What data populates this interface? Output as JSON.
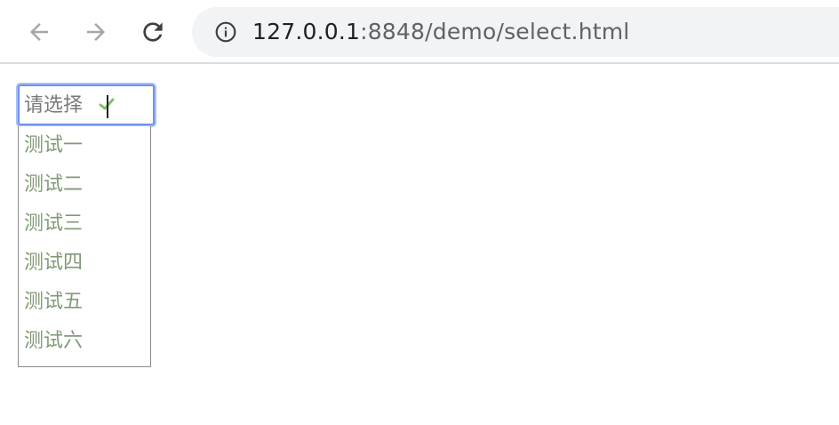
{
  "browser": {
    "url_host": "127.0.0.1",
    "url_path": ":8848/demo/select.html"
  },
  "select": {
    "value": "请选择",
    "options": [
      {
        "label": "测试一"
      },
      {
        "label": "测试二"
      },
      {
        "label": "测试三"
      },
      {
        "label": "测试四"
      },
      {
        "label": "测试五"
      },
      {
        "label": "测试六"
      }
    ]
  },
  "colors": {
    "focus_border": "#6f92f0",
    "option_text": "#809a76",
    "check": "#7cc36a"
  }
}
